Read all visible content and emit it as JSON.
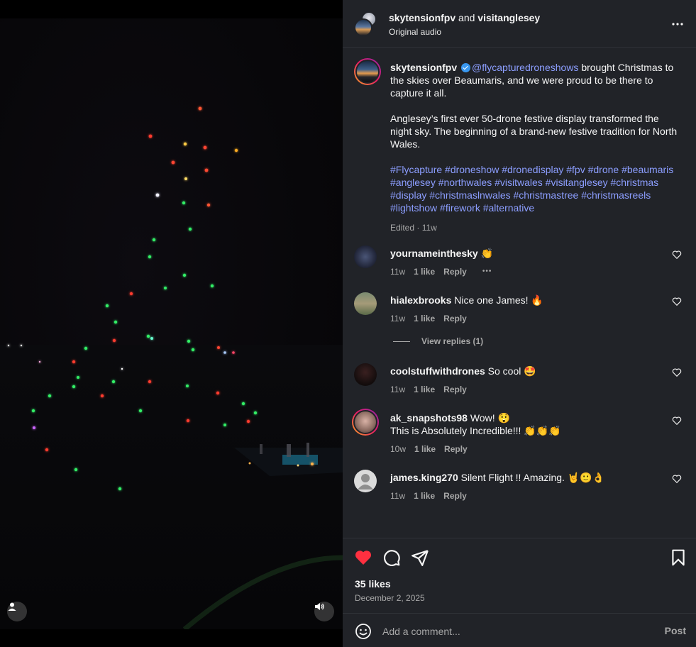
{
  "header": {
    "user1": "skytensionfpv",
    "and": "and",
    "user2": "visitanglesey",
    "audio": "Original audio",
    "more_icon": "more-horizontal-icon"
  },
  "caption": {
    "username": "skytensionfpv",
    "mention": "@flycapturedroneshows",
    "line1_rest": " brought Christmas to the skies over Beaumaris, and we were proud to be there to capture it all.",
    "para2": "Anglesey’s first ever 50-drone festive display transformed the night sky. The beginning of a brand-new festive tradition for North Wales.",
    "hashtags": "#Flycapture #droneshow #dronedisplay #fpv #drone #beaumaris #anglesey #northwales #visitwales #visitanglesey #christmas #display #christmaslnwales #christmastree #christmasreels #lightshow #firework #alternative",
    "edited": "Edited · 11w"
  },
  "comments": [
    {
      "username": "yournameinthesky",
      "text": "👏",
      "time": "11w",
      "likes": "1 like",
      "reply": "Reply",
      "extra": "•••"
    },
    {
      "username": "hialexbrooks",
      "text": "Nice one James! 🔥",
      "time": "11w",
      "likes": "1 like",
      "reply": "Reply"
    },
    {
      "username": "coolstuffwithdrones",
      "text": "So cool 🤩",
      "time": "11w",
      "likes": "1 like",
      "reply": "Reply"
    },
    {
      "username": "ak_snapshots98",
      "text": "Wow! 😲",
      "text2": "This is Absolutely Incredible!!! 👏👏👏",
      "time": "10w",
      "likes": "1 like",
      "reply": "Reply"
    },
    {
      "username": "james.king270",
      "text": "Silent Flight !! Amazing. 🤘🙂👌",
      "time": "11w",
      "likes": "1 like",
      "reply": "Reply"
    }
  ],
  "view_replies": "View replies (1)",
  "actions": {
    "likes": "35 likes",
    "date": "December 2, 2025",
    "like_color": "#ff3040"
  },
  "add_comment": {
    "placeholder": "Add a comment...",
    "post": "Post"
  }
}
